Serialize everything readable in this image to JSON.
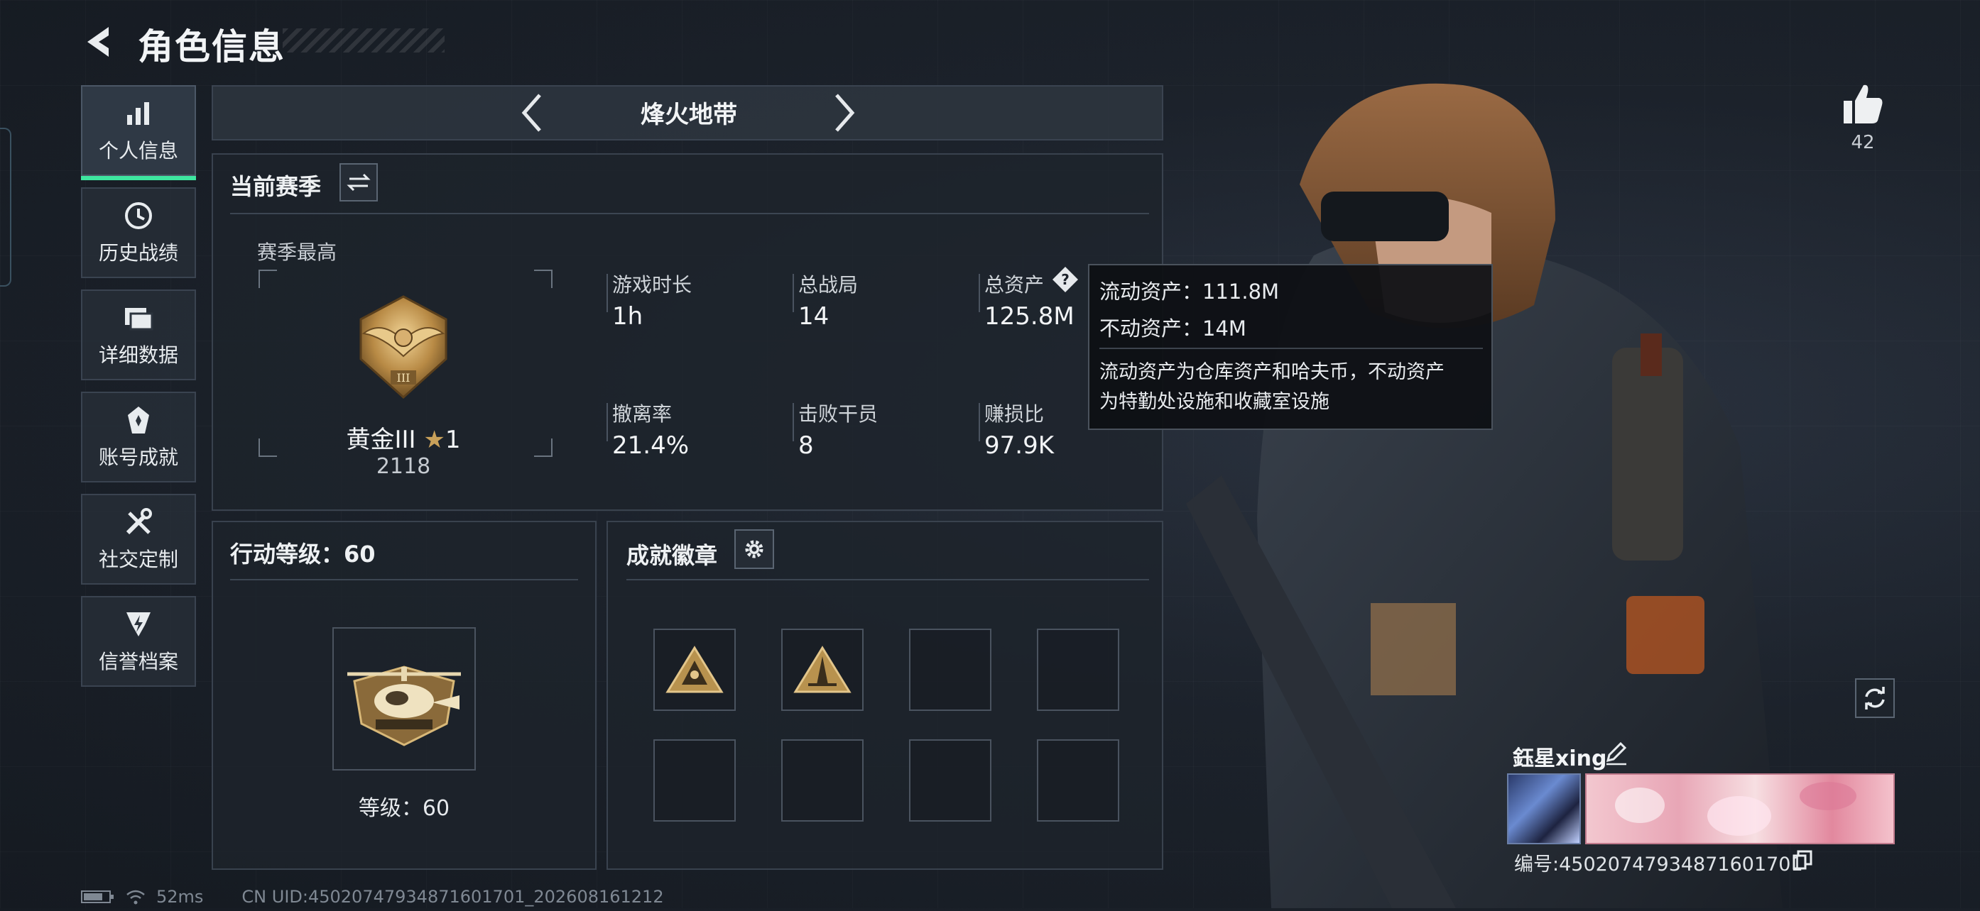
{
  "header": {
    "title": "角色信息"
  },
  "nav": [
    {
      "label": "个人信息",
      "icon": "bar-chart-icon",
      "active": true
    },
    {
      "label": "历史战绩",
      "icon": "history-icon",
      "active": false
    },
    {
      "label": "详细数据",
      "icon": "folder-icon",
      "active": false
    },
    {
      "label": "账号成就",
      "icon": "achievement-icon",
      "active": false
    },
    {
      "label": "社交定制",
      "icon": "tools-icon",
      "active": false
    },
    {
      "label": "信誉档案",
      "icon": "shield-bolt-icon",
      "active": false
    }
  ],
  "mode": {
    "label": "烽火地带"
  },
  "season": {
    "title": "当前赛季",
    "best_label": "赛季最高",
    "rank_name": "黄金III",
    "rank_star_count": "1",
    "rank_score": "2118",
    "stats": [
      {
        "label": "游戏时长",
        "value": "1h"
      },
      {
        "label": "总战局",
        "value": "14"
      },
      {
        "label": "总资产",
        "value": "125.8M"
      },
      {
        "label": "撤离率",
        "value": "21.4%"
      },
      {
        "label": "击败干员",
        "value": "8"
      },
      {
        "label": "赚损比",
        "value": "97.9K"
      }
    ]
  },
  "tooltip": {
    "liquid": "流动资产：111.8M",
    "fixed": "不动资产：14M",
    "desc_line1": "流动资产为仓库资产和哈夫币，不动资产",
    "desc_line2": "为特勤处设施和收藏室设施"
  },
  "action_level": {
    "title": "行动等级：60",
    "level_label": "等级：60"
  },
  "badges": {
    "title": "成就徽章",
    "slots_filled": 2,
    "slots_total": 8
  },
  "profile": {
    "like_count": "42",
    "name": "鈺星xing",
    "id_text": "编号:4502074793487160170​1"
  },
  "footer": {
    "ping": "52ms",
    "uid": "CN UID:45020747934871601701_202608161212"
  },
  "colors": {
    "accent": "#3ee6a0",
    "gold": "#c9a15a",
    "panel": "#1e242c"
  }
}
